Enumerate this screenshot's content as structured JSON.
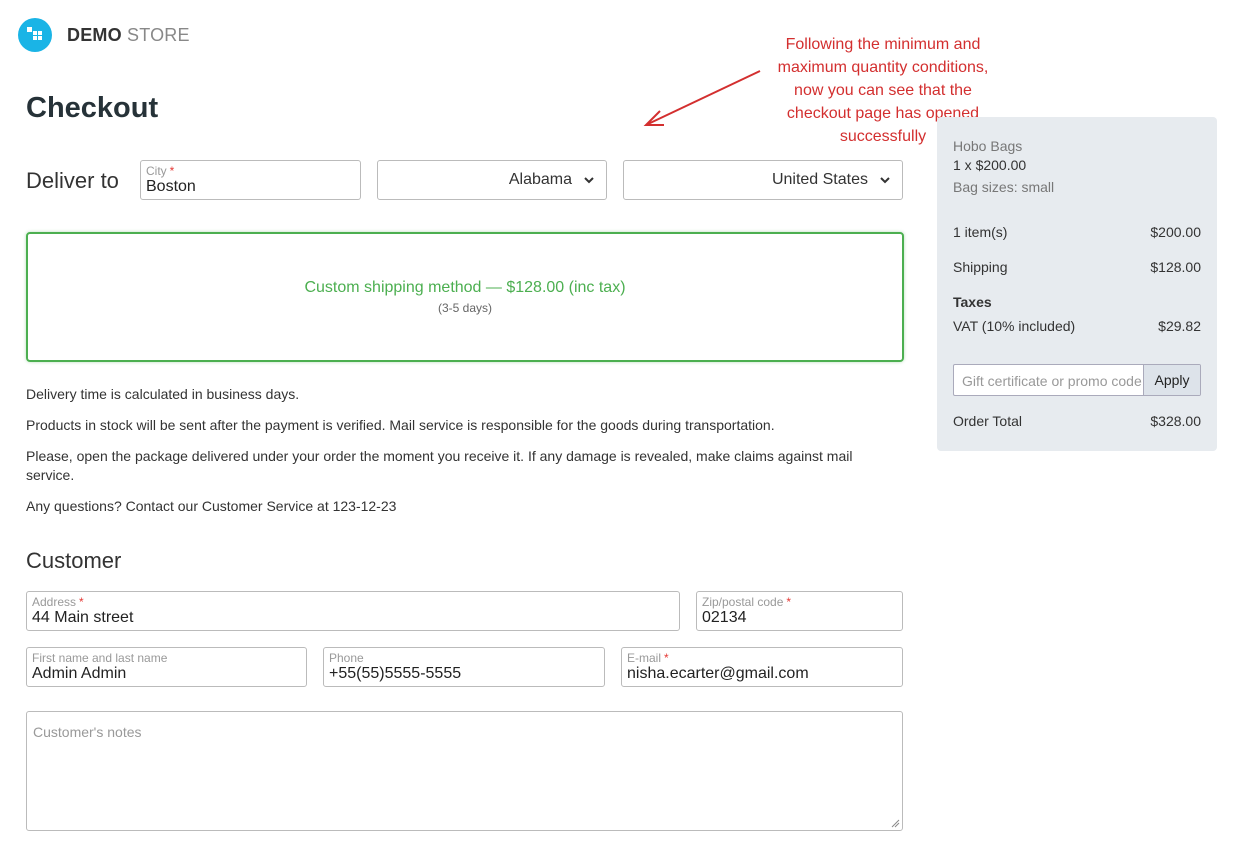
{
  "header": {
    "logo_bold": "DEMO",
    "logo_light": "STORE",
    "logo_icon": "store-logo-icon"
  },
  "page": {
    "title": "Checkout"
  },
  "annotation": {
    "text_lines": [
      "Following the minimum and",
      "maximum quantity conditions,",
      "now you can see that the",
      "checkout page has opened",
      "successfully"
    ],
    "color": "#d32f2f"
  },
  "delivery": {
    "label": "Deliver to",
    "city_label": "City",
    "city_required": "*",
    "city_value": "Boston",
    "state_value": "Alabama",
    "country_value": "United States"
  },
  "shipping": {
    "method": "Custom shipping method — $128.00 (inc tax)",
    "days": "(3-5 days)",
    "accent_color": "#4caf50"
  },
  "info": {
    "lines": [
      "Delivery time is calculated in business days.",
      "Products in stock will be sent after the payment is verified. Mail service is responsible for the goods during transportation.",
      "Please, open the package delivered under your order the moment you receive it. If any damage is revealed, make claims against mail service.",
      "Any questions? Contact our Customer Service at 123-12-23"
    ]
  },
  "customer": {
    "heading": "Customer",
    "address_label": "Address",
    "address_value": "44 Main street",
    "zip_label": "Zip/postal code",
    "zip_value": "02134",
    "name_label": "First name and last name",
    "name_value": "Admin Admin",
    "phone_label": "Phone",
    "phone_value": "+55(55)5555-5555",
    "email_label": "E-mail",
    "email_value": "nisha.ecarter@gmail.com",
    "required_mark": "*",
    "notes_placeholder": "Customer's notes"
  },
  "summary": {
    "product_name": "Hobo Bags",
    "product_qty_price": "1 x $200.00",
    "product_option": "Bag sizes: small",
    "items_label": "1 item(s)",
    "items_amount": "$200.00",
    "shipping_label": "Shipping",
    "shipping_amount": "$128.00",
    "taxes_label": "Taxes",
    "vat_label": "VAT (10% included)",
    "vat_amount": "$29.82",
    "promo_placeholder": "Gift certificate or promo code",
    "apply_label": "Apply",
    "total_label": "Order Total",
    "total_amount": "$328.00"
  }
}
